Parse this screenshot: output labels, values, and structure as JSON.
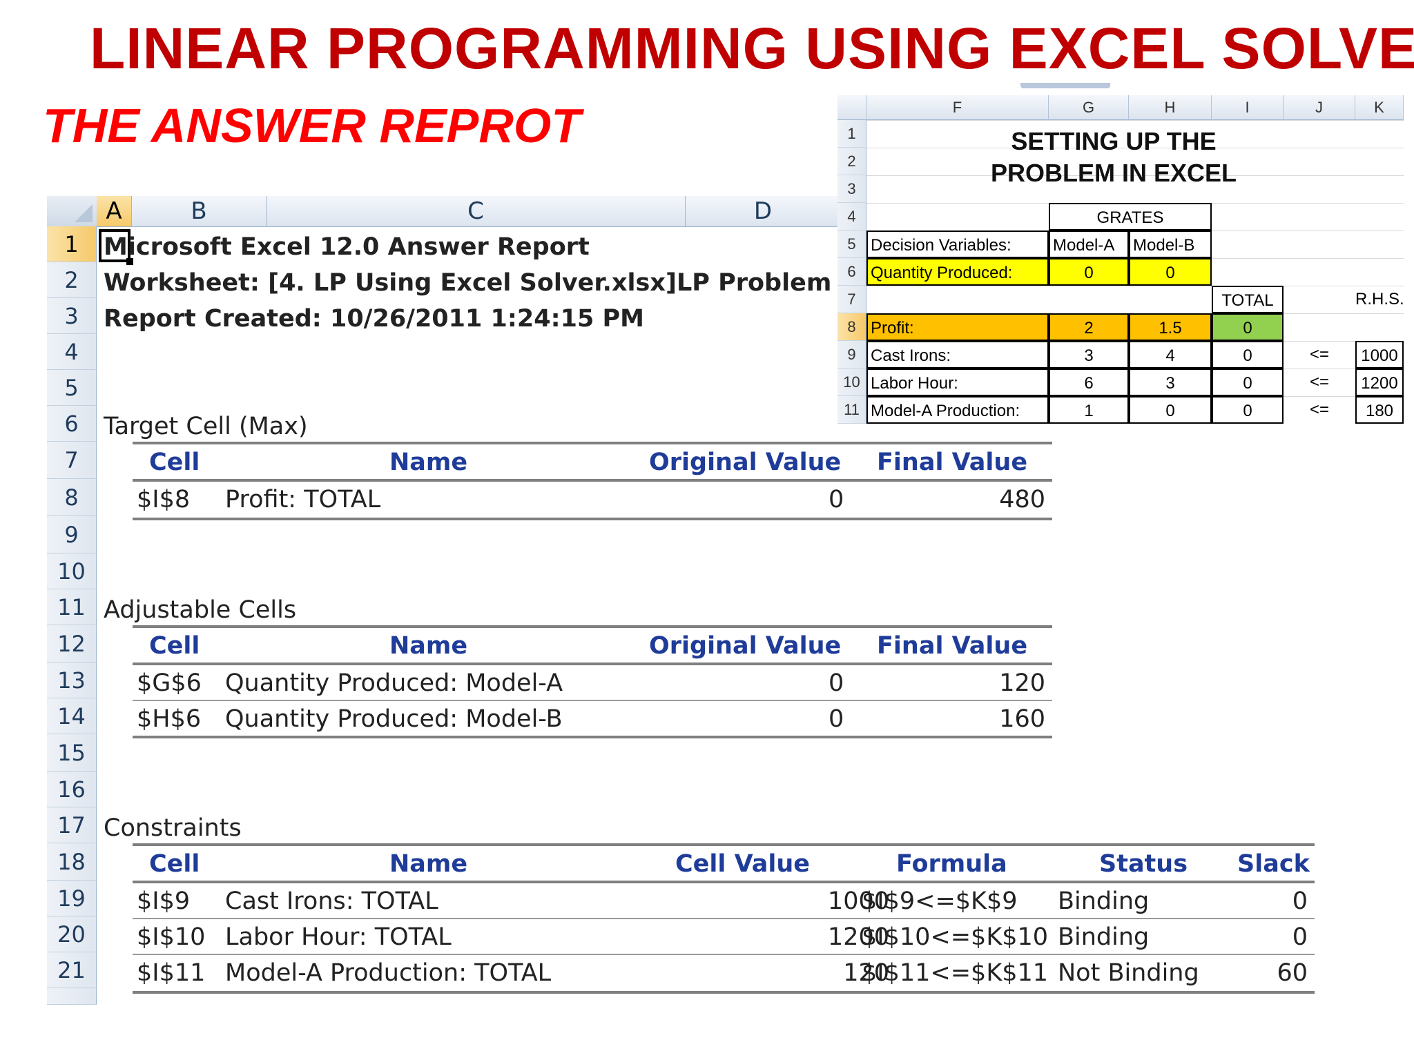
{
  "slide": {
    "title": "LINEAR PROGRAMMING USING EXCEL SOLVER",
    "subtitle": "THE ANSWER REPROT",
    "title_color": "#c00000",
    "subtitle_color": "#ff0000"
  },
  "report": {
    "columns": [
      "A",
      "B",
      "C",
      "D"
    ],
    "rows": [
      "1",
      "2",
      "3",
      "4",
      "5",
      "6",
      "7",
      "8",
      "9",
      "10",
      "11",
      "12",
      "13",
      "14",
      "15",
      "16",
      "17",
      "18",
      "19",
      "20",
      "21"
    ],
    "line1": "Microsoft Excel 12.0 Answer Report",
    "line2": "Worksheet: [4. LP Using Excel Solver.xlsx]LP Problem",
    "line3": "Report Created: 10/26/2011 1:24:15 PM",
    "target": {
      "heading": "Target Cell (Max)",
      "headers": [
        "Cell",
        "Name",
        "Original Value",
        "Final Value"
      ],
      "rows": [
        {
          "cell": "$I$8",
          "name": "Profit: TOTAL",
          "original": "0",
          "final": "480"
        }
      ]
    },
    "adjustable": {
      "heading": "Adjustable Cells",
      "headers": [
        "Cell",
        "Name",
        "Original Value",
        "Final Value"
      ],
      "rows": [
        {
          "cell": "$G$6",
          "name": "Quantity Produced: Model-A",
          "original": "0",
          "final": "120"
        },
        {
          "cell": "$H$6",
          "name": "Quantity Produced: Model-B",
          "original": "0",
          "final": "160"
        }
      ]
    },
    "constraints": {
      "heading": "Constraints",
      "headers": [
        "Cell",
        "Name",
        "Cell Value",
        "Formula",
        "Status",
        "Slack"
      ],
      "rows": [
        {
          "cell": "$I$9",
          "name": "Cast Irons: TOTAL",
          "value": "1000",
          "formula": "$I$9<=$K$9",
          "status": "Binding",
          "slack": "0"
        },
        {
          "cell": "$I$10",
          "name": "Labor Hour: TOTAL",
          "value": "1200",
          "formula": "$I$10<=$K$10",
          "status": "Binding",
          "slack": "0"
        },
        {
          "cell": "$I$11",
          "name": "Model-A Production: TOTAL",
          "value": "120",
          "formula": "$I$11<=$K$11",
          "status": "Not Binding",
          "slack": "60"
        }
      ]
    }
  },
  "inset": {
    "columns": [
      "F",
      "G",
      "H",
      "I",
      "J",
      "K"
    ],
    "rows": [
      "1",
      "2",
      "3",
      "4",
      "5",
      "6",
      "7",
      "8",
      "9",
      "10",
      "11"
    ],
    "title_line1": "SETTING UP THE",
    "title_line2": "PROBLEM IN EXCEL",
    "grates": "GRATES",
    "decision_label": "Decision Variables:",
    "model_a": "Model-A",
    "model_b": "Model-B",
    "qty_label": "Quantity Produced:",
    "qty_a": "0",
    "qty_b": "0",
    "total": "TOTAL",
    "rhs": "R.H.S.",
    "profit_label": "Profit:",
    "profit_a": "2",
    "profit_b": "1.5",
    "profit_total": "0",
    "constraint_rows": [
      {
        "label": "Cast Irons:",
        "a": "3",
        "b": "4",
        "total": "0",
        "op": "<=",
        "rhs": "1000"
      },
      {
        "label": "Labor Hour:",
        "a": "6",
        "b": "3",
        "total": "0",
        "op": "<=",
        "rhs": "1200"
      },
      {
        "label": "Model-A Production:",
        "a": "1",
        "b": "0",
        "total": "0",
        "op": "<=",
        "rhs": "180"
      }
    ],
    "colors": {
      "yellow": "#ffff00",
      "orange": "#ffc000",
      "green": "#92d050"
    }
  }
}
